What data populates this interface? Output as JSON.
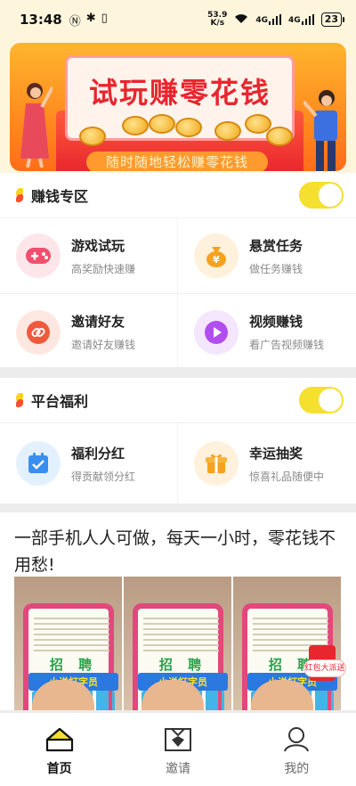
{
  "status_bar": {
    "time": "13:48",
    "net_speed_value": "53.9",
    "net_speed_unit": "K/s",
    "signal_1": "4G",
    "signal_2": "4G",
    "battery": "23"
  },
  "banner": {
    "title": "试玩赚零花钱",
    "subtitle": "随时随地轻松赚零花钱"
  },
  "earn_section": {
    "title": "赚钱专区",
    "toggle_on": true,
    "items": [
      {
        "title": "游戏试玩",
        "desc": "高奖励快速赚",
        "icon": "gamepad-icon",
        "icon_bg": "#fde6ea",
        "icon_color": "#f0506e"
      },
      {
        "title": "悬赏任务",
        "desc": "做任务赚钱",
        "icon": "money-bag-icon",
        "icon_bg": "#fff1dc",
        "icon_color": "#f6a21e"
      },
      {
        "title": "邀请好友",
        "desc": "邀请好友赚钱",
        "icon": "link-icon",
        "icon_bg": "#ffe7e1",
        "icon_color": "#ef5a3c"
      },
      {
        "title": "视频赚钱",
        "desc": "看广告视频赚钱",
        "icon": "play-icon",
        "icon_bg": "#f4e6ff",
        "icon_color": "#b24ef0"
      }
    ]
  },
  "welfare_section": {
    "title": "平台福利",
    "toggle_on": true,
    "items": [
      {
        "title": "福利分红",
        "desc": "得贡献领分红",
        "icon": "calendar-check-icon",
        "icon_bg": "#e3f1ff",
        "icon_color": "#3a8ef0"
      },
      {
        "title": "幸运抽奖",
        "desc": "惊喜礼品随便中",
        "icon": "gift-icon",
        "icon_bg": "#fff1dc",
        "icon_color": "#f6a21e"
      }
    ]
  },
  "article": {
    "headline": "一部手机人人可做，每天一小时，零花钱不用愁!",
    "thumb_text_1": "招 聘",
    "thumb_text_2": "小说打字员",
    "float_badge": "红包大派送"
  },
  "tab_bar": {
    "tabs": [
      {
        "label": "首页",
        "icon": "home-icon",
        "active": true
      },
      {
        "label": "邀请",
        "icon": "invite-icon",
        "active": false
      },
      {
        "label": "我的",
        "icon": "profile-icon",
        "active": false
      }
    ]
  },
  "colors": {
    "accent_yellow": "#f5df2f",
    "brand_red": "#e8262e",
    "header_bg": "#fdf6dc"
  }
}
